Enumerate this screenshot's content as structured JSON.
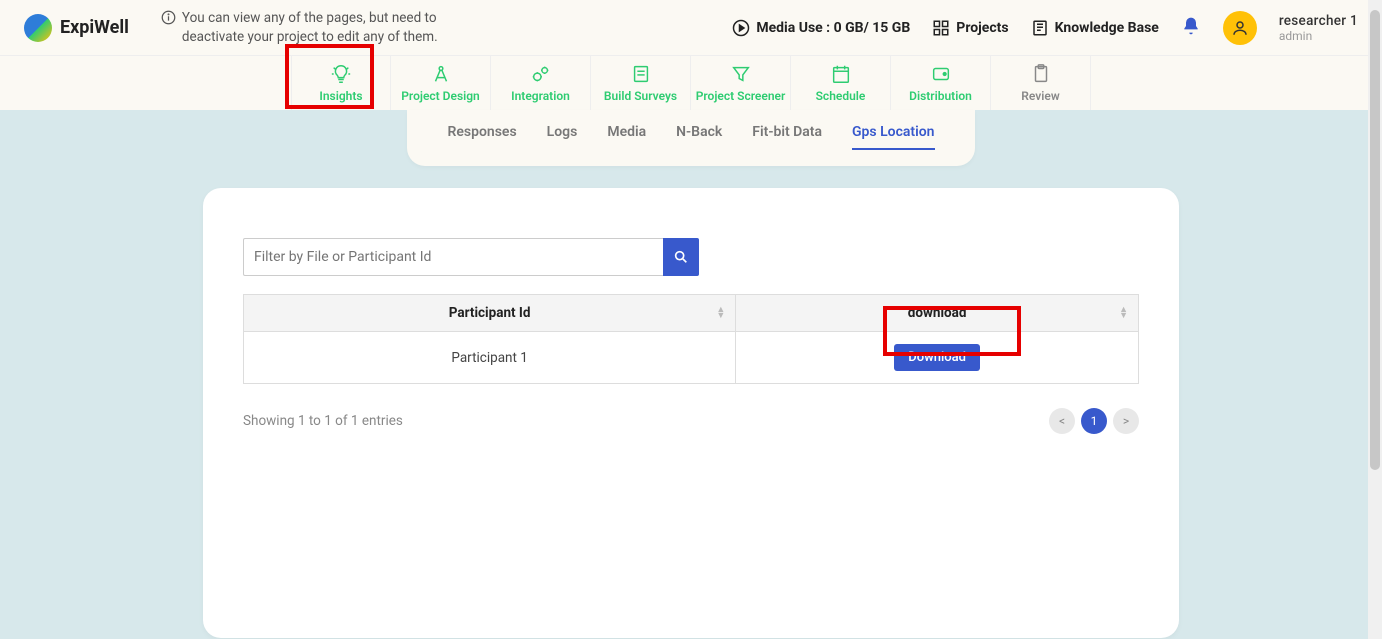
{
  "header": {
    "logo_text": "ExpiWell",
    "info_text": "You can view any of the pages, but need to deactivate your project to edit any of them.",
    "media_use_label": "Media Use : 0 GB/ 15 GB",
    "projects_label": "Projects",
    "knowledge_base_label": "Knowledge Base",
    "user_name": "researcher 1",
    "user_role": "admin"
  },
  "main_nav": [
    {
      "label": "Insights"
    },
    {
      "label": "Project Design"
    },
    {
      "label": "Integration"
    },
    {
      "label": "Build Surveys"
    },
    {
      "label": "Project Screener"
    },
    {
      "label": "Schedule"
    },
    {
      "label": "Distribution"
    },
    {
      "label": "Review"
    }
  ],
  "sub_tabs": [
    {
      "label": "Responses"
    },
    {
      "label": "Logs"
    },
    {
      "label": "Media"
    },
    {
      "label": "N-Back"
    },
    {
      "label": "Fit-bit Data"
    },
    {
      "label": "Gps Location"
    }
  ],
  "filter": {
    "placeholder": "Filter by File or Participant Id"
  },
  "table": {
    "col_participant": "Participant Id",
    "col_download": "download",
    "rows": [
      {
        "participant": "Participant 1",
        "download_label": "Download"
      }
    ]
  },
  "footer": {
    "entries_text": "Showing 1 to 1 of 1 entries",
    "prev": "<",
    "page1": "1",
    "next": ">"
  }
}
